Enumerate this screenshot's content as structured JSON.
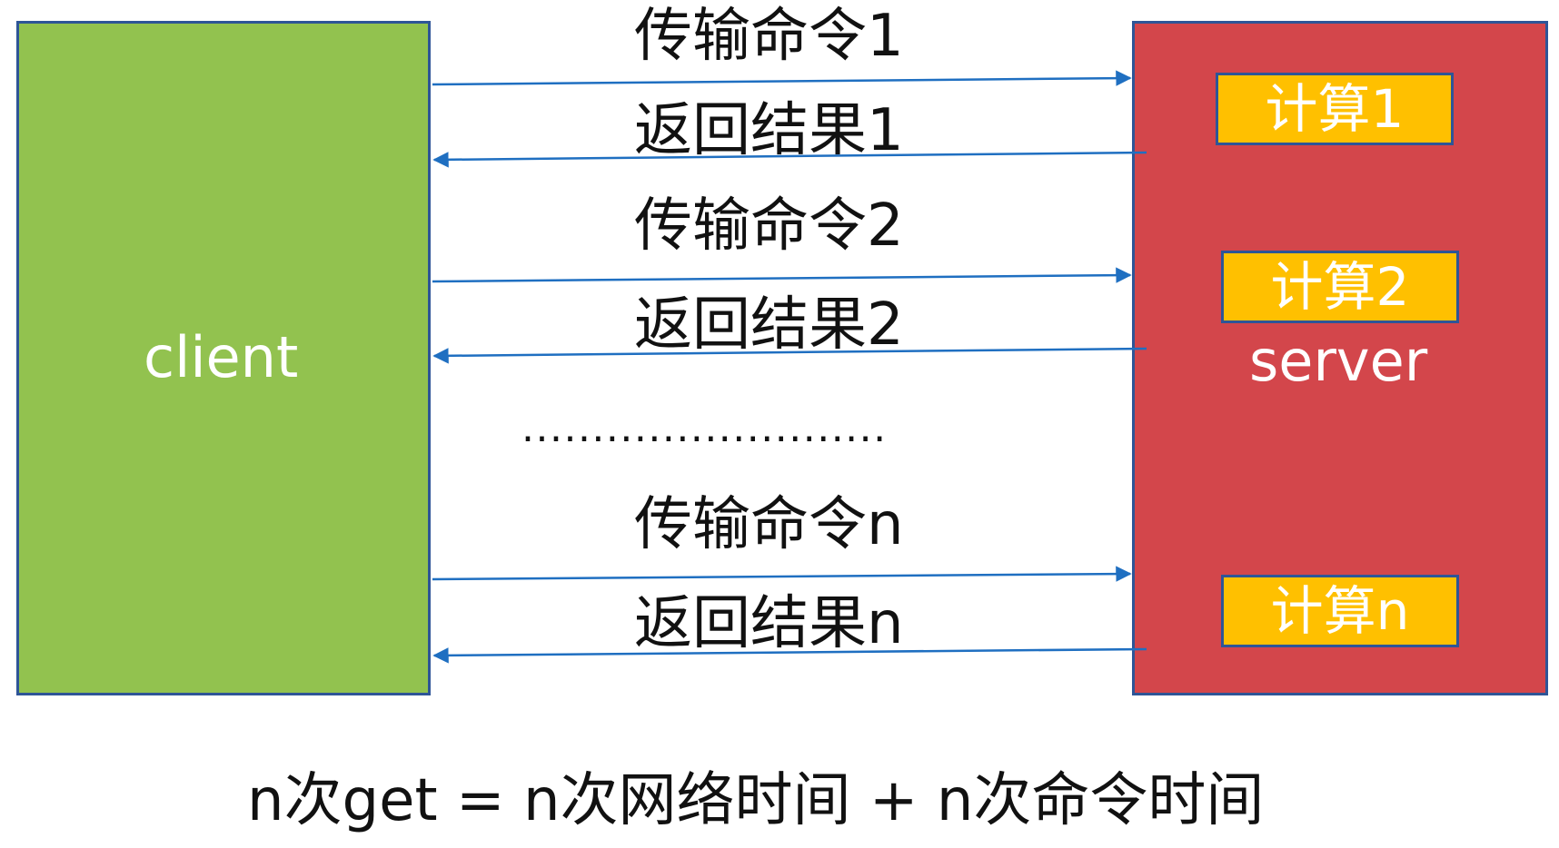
{
  "nodes": {
    "client": "client",
    "server": "server"
  },
  "computations": [
    "计算1",
    "计算2",
    "计算n"
  ],
  "messages": [
    {
      "send": "传输命令1",
      "return": "返回结果1"
    },
    {
      "send": "传输命令2",
      "return": "返回结果2"
    },
    {
      "send": "传输命令n",
      "return": "返回结果n"
    }
  ],
  "ellipsis": "..........................",
  "formula": "n次get = n次网络时间 + n次命令时间",
  "colors": {
    "client_fill": "#92c24f",
    "server_fill": "#d3464b",
    "compute_fill": "#ffc000",
    "border": "#2e5597",
    "arrow": "#1f6fc1"
  }
}
